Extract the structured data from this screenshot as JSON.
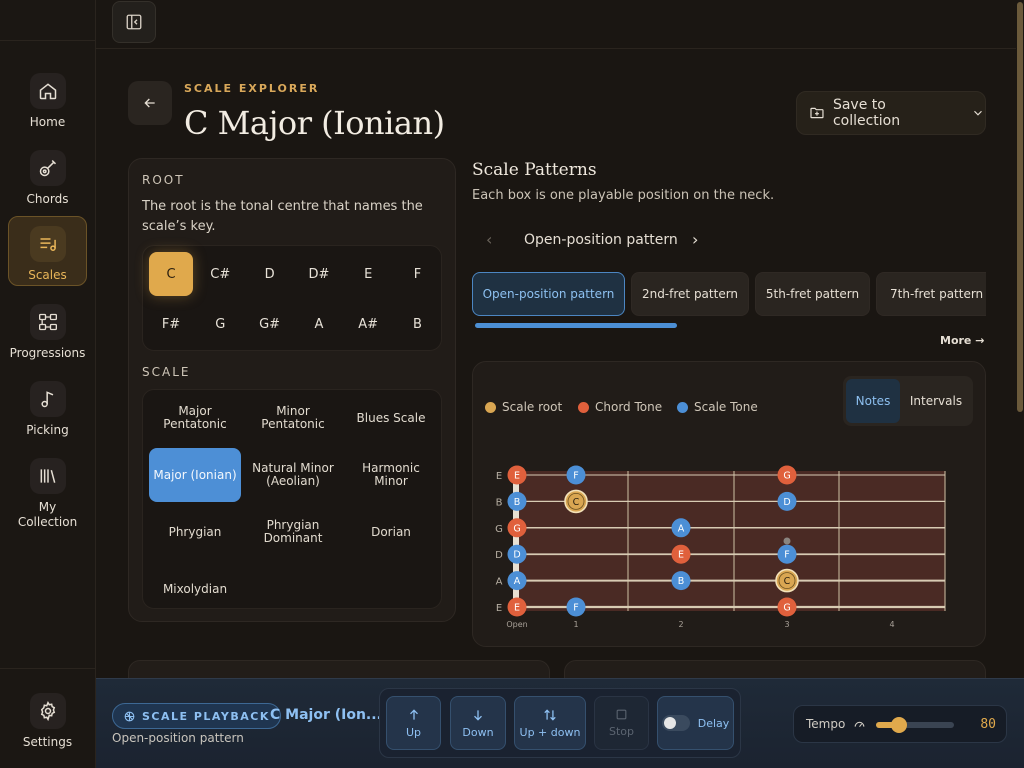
{
  "sidebar": {
    "items": [
      {
        "label": "Home",
        "icon": "home-icon"
      },
      {
        "label": "Chords",
        "icon": "guitar-icon"
      },
      {
        "label": "Scales",
        "icon": "scale-list-icon",
        "active": true
      },
      {
        "label": "Progressions",
        "icon": "progression-icon"
      },
      {
        "label": "Picking",
        "icon": "music-note-icon"
      },
      {
        "label": "My Collection",
        "icon": "library-icon"
      }
    ],
    "settings_label": "Settings"
  },
  "header": {
    "eyebrow": "SCALE EXPLORER",
    "title": "C Major (Ionian)",
    "save_label": "Save to collection"
  },
  "root": {
    "label": "ROOT",
    "description": "The root is the tonal centre that names the scale’s key.",
    "keys": [
      "C",
      "C#",
      "D",
      "D#",
      "E",
      "F",
      "F#",
      "G",
      "G#",
      "A",
      "A#",
      "B"
    ],
    "selected": "C"
  },
  "scale": {
    "label": "SCALE",
    "options": [
      "Major Pentatonic",
      "Minor Pentatonic",
      "Blues Scale",
      "Major (Ionian)",
      "Natural Minor (Aeolian)",
      "Harmonic Minor",
      "Phrygian",
      "Phrygian Dominant",
      "Dorian",
      "Mixolydian"
    ],
    "selected": "Major (Ionian)"
  },
  "patterns": {
    "title": "Scale Patterns",
    "description": "Each box is one playable position on the neck.",
    "current": "Open-position pattern",
    "tabs": [
      "Open-position pattern",
      "2nd-fret pattern",
      "5th-fret pattern",
      "7th-fret pattern"
    ],
    "more_label": "More →"
  },
  "fretboard": {
    "legend": [
      {
        "label": "Scale root",
        "color": "#d9a652"
      },
      {
        "label": "Chord Tone",
        "color": "#e0603c"
      },
      {
        "label": "Scale Tone",
        "color": "#4c8fd6"
      }
    ],
    "view_options": [
      "Notes",
      "Intervals"
    ],
    "view_selected": "Notes",
    "strings": [
      "E",
      "B",
      "G",
      "D",
      "A",
      "E"
    ],
    "fret_labels": [
      "Open",
      "1",
      "2",
      "3",
      "4"
    ],
    "notes": [
      {
        "string": 0,
        "fret": 0,
        "note": "E",
        "type": "chord"
      },
      {
        "string": 0,
        "fret": 1,
        "note": "F",
        "type": "scale"
      },
      {
        "string": 0,
        "fret": 3,
        "note": "G",
        "type": "chord"
      },
      {
        "string": 1,
        "fret": 0,
        "note": "B",
        "type": "scale"
      },
      {
        "string": 1,
        "fret": 1,
        "note": "C",
        "type": "root"
      },
      {
        "string": 1,
        "fret": 3,
        "note": "D",
        "type": "scale"
      },
      {
        "string": 2,
        "fret": 0,
        "note": "G",
        "type": "chord"
      },
      {
        "string": 2,
        "fret": 2,
        "note": "A",
        "type": "scale"
      },
      {
        "string": 3,
        "fret": 0,
        "note": "D",
        "type": "scale"
      },
      {
        "string": 3,
        "fret": 2,
        "note": "E",
        "type": "chord"
      },
      {
        "string": 3,
        "fret": 3,
        "note": "F",
        "type": "scale"
      },
      {
        "string": 4,
        "fret": 0,
        "note": "A",
        "type": "scale"
      },
      {
        "string": 4,
        "fret": 2,
        "note": "B",
        "type": "scale"
      },
      {
        "string": 4,
        "fret": 3,
        "note": "C",
        "type": "root"
      },
      {
        "string": 5,
        "fret": 0,
        "note": "E",
        "type": "chord"
      },
      {
        "string": 5,
        "fret": 1,
        "note": "F",
        "type": "scale"
      },
      {
        "string": 5,
        "fret": 3,
        "note": "G",
        "type": "chord"
      }
    ]
  },
  "playback": {
    "badge": "SCALE PLAYBACK",
    "title": "C Major (Ion...",
    "subtitle": "Open-position pattern",
    "buttons": [
      "Up",
      "Down",
      "Up + down",
      "Stop"
    ],
    "delay_label": "Delay",
    "tempo_label": "Tempo",
    "tempo_value": "80",
    "tempo_fraction": 0.3
  },
  "colors": {
    "accent": "#e0a94c",
    "blue": "#4c8fd6",
    "chord": "#e0603c"
  }
}
